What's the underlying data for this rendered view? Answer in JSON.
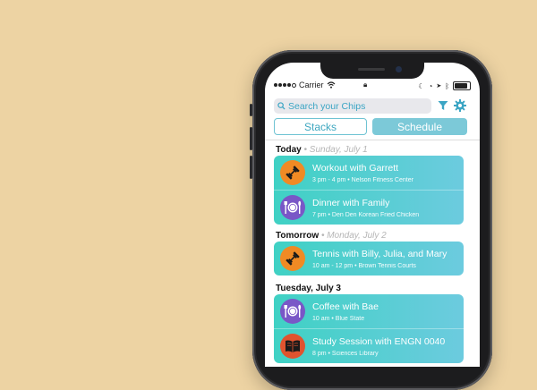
{
  "status_bar": {
    "carrier": "Carrier"
  },
  "search": {
    "placeholder": "Search your Chips"
  },
  "segments": {
    "stacks": "Stacks",
    "schedule": "Schedule"
  },
  "days": [
    {
      "label": "Today",
      "sub": "• Sunday, July 1",
      "events": [
        {
          "title": "Workout with Garrett",
          "meta": "3 pm - 4 pm • Nelson Fitness Center",
          "icon": "dumbbell-icon",
          "color": "#f08a24"
        },
        {
          "title": "Dinner with Family",
          "meta": "7 pm • Den Den Korean Fried Chicken",
          "icon": "plate-icon",
          "color": "#7957c7"
        }
      ]
    },
    {
      "label": "Tomorrow",
      "sub": "• Monday, July 2",
      "events": [
        {
          "title": "Tennis with Billy, Julia, and Mary",
          "meta": "10 am - 12 pm • Brown Tennis Courts",
          "icon": "dumbbell-icon",
          "color": "#f08a24"
        }
      ]
    },
    {
      "label": "Tuesday, July 3",
      "sub": "",
      "events": [
        {
          "title": "Coffee with Bae",
          "meta": "10 am • Blue State",
          "icon": "plate-icon",
          "color": "#7957c7"
        },
        {
          "title": "Study Session with ENGN 0040",
          "meta": "8 pm • Sciences Library",
          "icon": "book-icon",
          "color": "#e0532f"
        }
      ]
    }
  ]
}
